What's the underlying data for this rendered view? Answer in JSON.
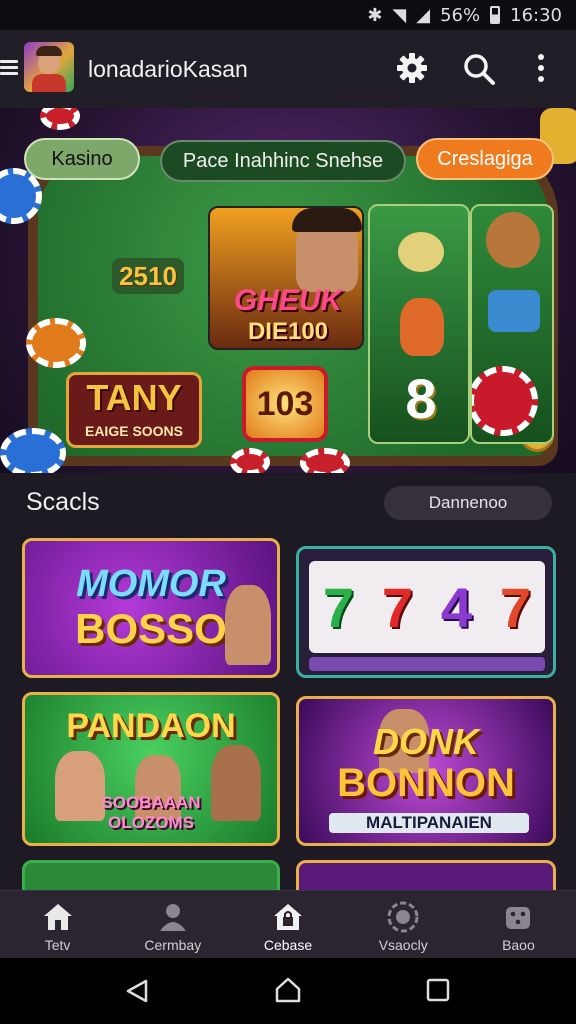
{
  "status_bar": {
    "battery": "56%",
    "time": "16:30"
  },
  "app_bar": {
    "title": "lonadarioKasan",
    "icons": [
      "menu-icon",
      "settings-icon",
      "search-icon",
      "more-vertical-icon"
    ]
  },
  "hero": {
    "pill_left": "Kasino",
    "pill_center": "Pace Inahhinc Snehse",
    "pill_right": "Creslagiga",
    "chip_value": "2510",
    "slot_main_line1": "GHEUK",
    "slot_main_line2": "DIE100",
    "sign_line1": "TANY",
    "sign_line2": "EAIGE SOONS",
    "badge_number": "103",
    "reel_number": "8"
  },
  "section": {
    "title": "Scacls",
    "button_label": "Dannenoo"
  },
  "tiles": [
    {
      "line1": "MOMOR",
      "line2": "BOSSO"
    },
    {
      "reels": [
        "7",
        "7",
        "4",
        "7"
      ]
    },
    {
      "line1": "PANDAON",
      "line2": "SOOBAAAN",
      "line3": "OLOZOMS"
    },
    {
      "line1": "DONK",
      "line2": "BONNON",
      "line3": "MALTIPANAIEN"
    }
  ],
  "bottom_nav": {
    "items": [
      {
        "label": "Tetv",
        "icon": "home-icon"
      },
      {
        "label": "Cermbay",
        "icon": "person-icon"
      },
      {
        "label": "Cebase",
        "icon": "house-lock-icon"
      },
      {
        "label": "Vsaocly",
        "icon": "chip-icon"
      },
      {
        "label": "Baoo",
        "icon": "dice-icon"
      }
    ]
  },
  "colors": {
    "accent_orange": "#f07a1e",
    "felt_green": "#2f8a3a",
    "gold": "#e8b04a",
    "purple": "#6a2a8a"
  }
}
